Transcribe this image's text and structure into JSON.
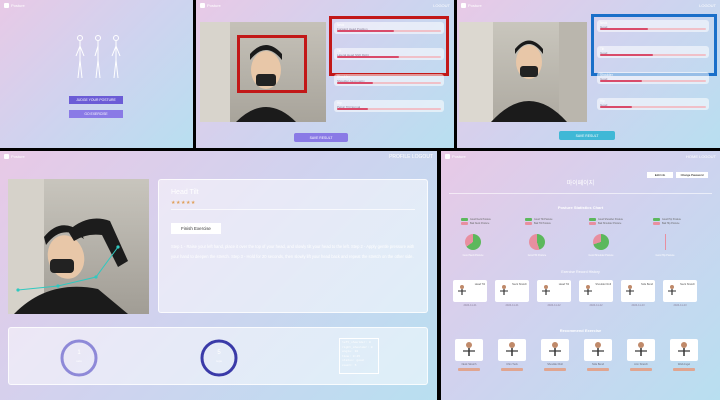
{
  "app": {
    "logo_text": "Posture",
    "top_right_small": "LOGOUT"
  },
  "panel1": {
    "btn_posture": "JUDGE YOUR POSTURE",
    "btn_exercise": "GO EXERCISE"
  },
  "panel2": {
    "metrics": [
      {
        "label": "Neck",
        "value": "Forward Head Position",
        "fill": 0.55
      },
      {
        "label": "Tilt",
        "value": "Lateral Head Shift Right",
        "fill": 0.6
      },
      {
        "label": "Shoulder",
        "value": "Shoulder Asymmetry",
        "fill": 0.35
      },
      {
        "label": "Hip",
        "value": "Pelvic Tilt Normal",
        "fill": 0.3
      }
    ],
    "save_btn": "SAVE RESULT"
  },
  "panel3": {
    "metrics": [
      {
        "label": "Neck",
        "value": "Good",
        "fill": 0.45
      },
      {
        "label": "Tilt",
        "value": "Good",
        "fill": 0.5
      },
      {
        "label": "Shoulder",
        "value": "Good",
        "fill": 0.4
      },
      {
        "label": "Hip",
        "value": "Good",
        "fill": 0.3
      }
    ],
    "save_btn": "SAVE RESULT"
  },
  "panel4": {
    "header_right": "PROFILE  LOGOUT",
    "exercise_title": "Head Tilt",
    "finish_btn": "Finish Exercise",
    "instructions": "Step 1 - Raise your left hand, place it over the top of your head, and slowly tilt your head to the left. Step 2 - Apply gentle pressure with your hand to deepen the stretch. Step 3 - Hold for 20 seconds, then slowly lift your head back and repeat the stretch on the other side.",
    "counter1": {
      "value": "1",
      "label": "sets"
    },
    "counter2": {
      "value": "5",
      "label": "reps"
    },
    "info_lines": [
      "left_shoulder: 0",
      "right_shoulder: 0",
      "angle: 32",
      "time: 0:45",
      "status: good",
      "count: 5"
    ]
  },
  "panel5": {
    "title": "마이페이지",
    "header_right": "HOME  LOGOUT",
    "top_btn1": "Edit Info",
    "top_btn2": "Change Password",
    "stats_title": "Posture Statistics Chart",
    "pies": [
      {
        "legend": [
          "Good Neck Posture",
          "Bad Neck Posture"
        ],
        "good": 0.65,
        "caption": "Good Neck Posture"
      },
      {
        "legend": [
          "Good Tilt Posture",
          "Bad Tilt Posture"
        ],
        "good": 0.45,
        "caption": "Good Tilt Posture"
      },
      {
        "legend": [
          "Good Shoulder Posture",
          "Bad Shoulder Posture"
        ],
        "good": 0.7,
        "caption": "Good Shoulder Posture"
      },
      {
        "legend": [
          "Good Hip Posture",
          "Bad Hip Posture"
        ],
        "good": 0.0,
        "caption": "Good Hip Posture"
      }
    ],
    "history_title": "Exercise Record History",
    "history": [
      {
        "label": "Head Tilt",
        "date": "2024-11-21"
      },
      {
        "label": "Neck Stretch",
        "date": "2024-11-21"
      },
      {
        "label": "Head Tilt",
        "date": "2024-11-22"
      },
      {
        "label": "Shoulder Roll",
        "date": "2024-11-22"
      },
      {
        "label": "Side Bend",
        "date": "2024-11-23"
      },
      {
        "label": "Neck Stretch",
        "date": "2024-11-23"
      }
    ],
    "rec_title": "Recommend Exercise",
    "recs": [
      "Neck Stretch",
      "Chin Tuck",
      "Shoulder Roll",
      "Side Bend",
      "Arm Stretch",
      "Wall Angel"
    ],
    "colors": {
      "good": "#5cb85c",
      "bad": "#e88fa0",
      "accent": "#4a3f9a"
    }
  }
}
